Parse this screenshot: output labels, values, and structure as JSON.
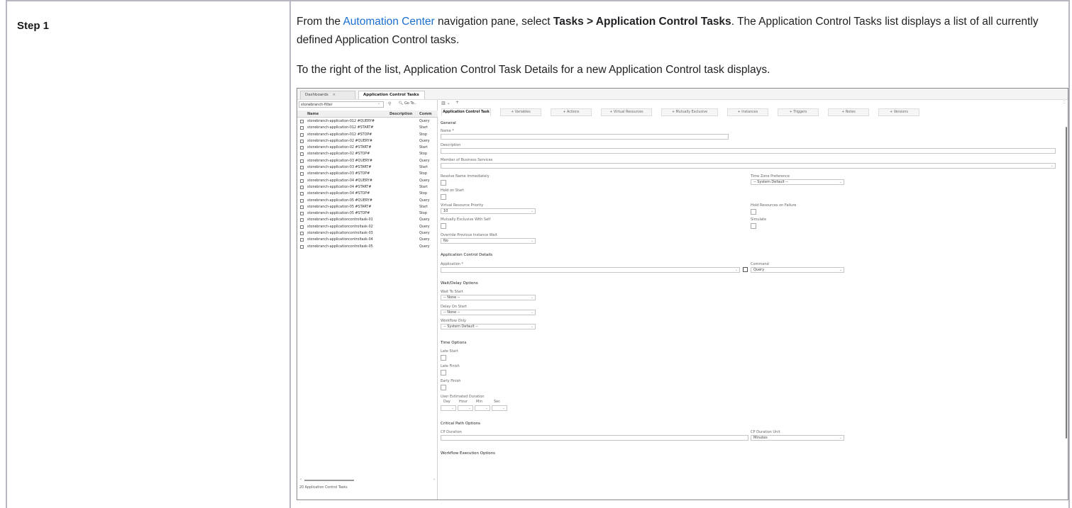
{
  "doc": {
    "step_label": "Step 1",
    "p1_pre": "From the ",
    "p1_link": "Automation Center",
    "p1_mid": " navigation pane, select ",
    "p1_bold": "Tasks > Application Control Tasks",
    "p1_post": ". The Application Control Tasks list displays a list of all currently defined Application Control tasks.",
    "p2": "To the right of the list, Application Control Task Details for a new Application Control task displays."
  },
  "screenshot": {
    "tabs": [
      {
        "label": "Dashboards",
        "close": "×"
      },
      {
        "label": "Application Control Tasks",
        "close": "×"
      }
    ],
    "filter_value": "stonebranch-filter",
    "goto_label": "Go To..",
    "list_headers": {
      "name": "Name",
      "description": "Description",
      "command": "Comm"
    },
    "rows": [
      {
        "name": "stonebranch-application-012 #QUERY#",
        "cmd": "Query"
      },
      {
        "name": "stonebranch-application-012 #START#",
        "cmd": "Start"
      },
      {
        "name": "stonebranch-application-012 #STOP#",
        "cmd": "Stop"
      },
      {
        "name": "stonebranch-application-02 #QUERY#",
        "cmd": "Query"
      },
      {
        "name": "stonebranch-application-02 #START#",
        "cmd": "Start"
      },
      {
        "name": "stonebranch-application-02 #STOP#",
        "cmd": "Stop"
      },
      {
        "name": "stonebranch-application-03 #QUERY#",
        "cmd": "Query"
      },
      {
        "name": "stonebranch-application-03 #START#",
        "cmd": "Start"
      },
      {
        "name": "stonebranch-application-03 #STOP#",
        "cmd": "Stop"
      },
      {
        "name": "stonebranch-application-04 #QUERY#",
        "cmd": "Query"
      },
      {
        "name": "stonebranch-application-04 #START#",
        "cmd": "Start"
      },
      {
        "name": "stonebranch-application-04 #STOP#",
        "cmd": "Stop"
      },
      {
        "name": "stonebranch-application-05 #QUERY#",
        "cmd": "Query"
      },
      {
        "name": "stonebranch-application-05 #START#",
        "cmd": "Start"
      },
      {
        "name": "stonebranch-application-05 #STOP#",
        "cmd": "Stop"
      },
      {
        "name": "stonebranch-applicationcontroltask-01",
        "cmd": "Query"
      },
      {
        "name": "stonebranch-applicationcontroltask-02",
        "cmd": "Query"
      },
      {
        "name": "stonebranch-applicationcontroltask-03",
        "cmd": "Query"
      },
      {
        "name": "stonebranch-applicationcontroltask-04",
        "cmd": "Query"
      },
      {
        "name": "stonebranch-applicationcontroltask-05",
        "cmd": "Query"
      }
    ],
    "count_label": "20 Application Control Tasks",
    "detail_tabs": [
      "Application Control Task",
      "+ Variables",
      "+ Actions",
      "+ Virtual Resources",
      "+ Mutually Exclusive",
      "+ Instances",
      "+ Triggers",
      "+ Notes",
      "+ Versions"
    ],
    "form": {
      "general": "General",
      "name": "Name *",
      "description": "Description",
      "member_bs": "Member of Business Services",
      "resolve_name": "Resolve Name Immediately",
      "tz_pref": "Time Zone Preference",
      "tz_value": "-- System Default --",
      "hold_on_start": "Hold on Start",
      "vr_priority": "Virtual Resource Priority",
      "vr_priority_value": "10",
      "hold_res_fail": "Hold Resources on Failure",
      "mutex_self": "Mutually Exclusive With Self",
      "simulate": "Simulate",
      "override_prev": "Override Previous Instance Wait",
      "override_value": "No",
      "acd": "Application Control Details",
      "application": "Application *",
      "command": "Command",
      "command_value": "Query",
      "wait_delay": "Wait/Delay Options",
      "wait_to_start": "Wait To Start",
      "wait_value": "-- None --",
      "delay_on_start": "Delay On Start",
      "delay_value": "-- None --",
      "workflow_only": "Workflow Only",
      "workflow_value": "-- System Default --",
      "time_options": "Time Options",
      "late_start": "Late Start",
      "late_finish": "Late Finish",
      "early_finish": "Early Finish",
      "user_est": "User Estimated Duration",
      "day": "Day",
      "hour": "Hour",
      "min": "Min",
      "sec": "Sec",
      "cp_options": "Critical Path Options",
      "cp_duration": "CP Duration",
      "cp_unit": "CP Duration Unit",
      "cp_unit_value": "Minutes",
      "wf_exec": "Workflow Execution Options"
    }
  }
}
